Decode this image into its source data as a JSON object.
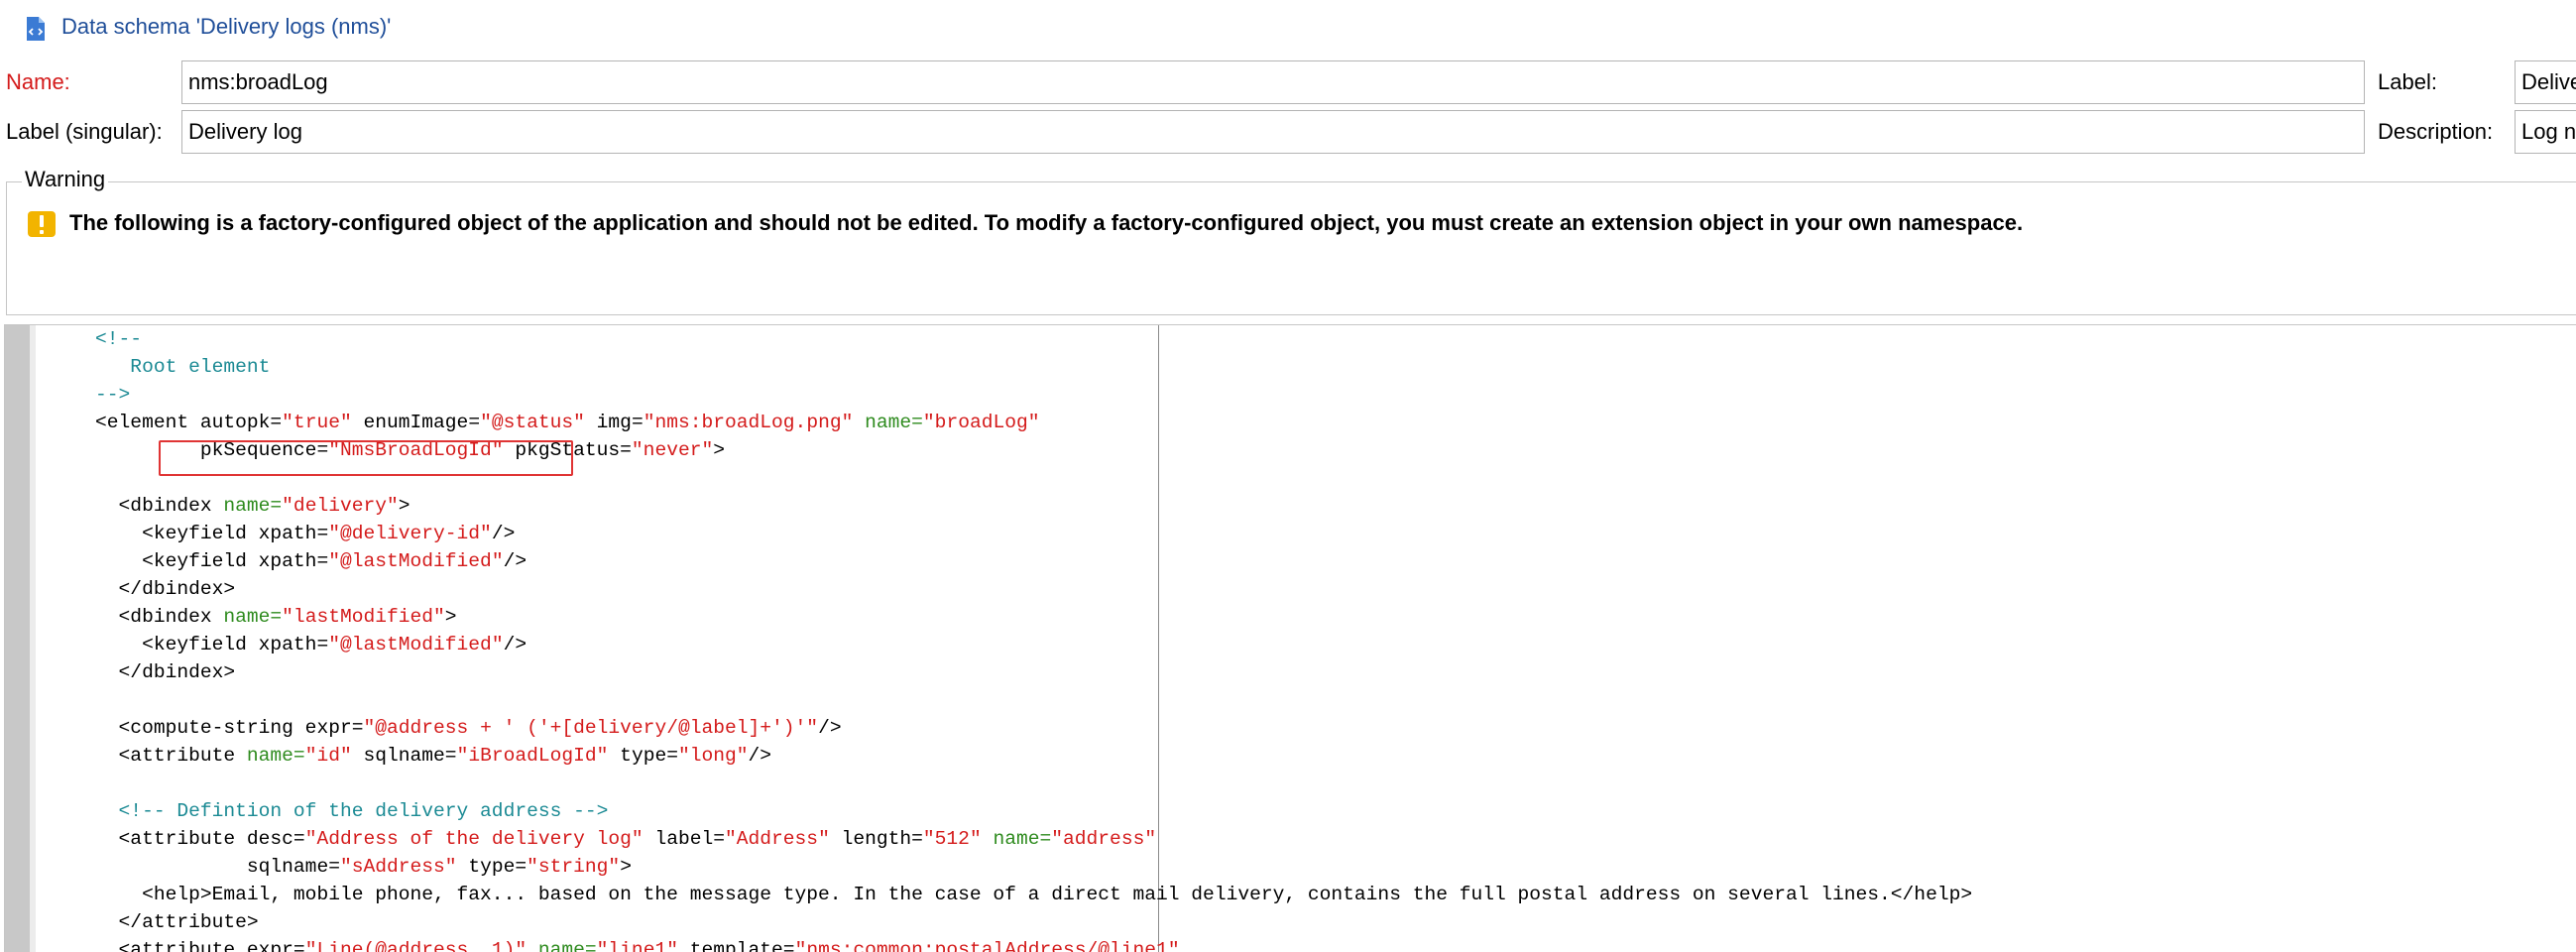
{
  "window": {
    "title": "Data schema 'Delivery logs (nms)'",
    "icon": "schema-document-icon"
  },
  "form": {
    "name_label": "Name:",
    "name_value": "nms:broadLog",
    "label_label": "Label:",
    "label_value": "Delive",
    "label_singular_label": "Label (singular):",
    "label_singular_value": "Delivery log",
    "description_label": "Description:",
    "description_value": "Log n"
  },
  "warning": {
    "legend": "Warning",
    "icon": "warning-exclamation-icon",
    "message": "The following is a factory-configured object of the application and should not be edited. To modify a factory-configured object, you must create an extension object in your own namespace."
  },
  "editor": {
    "lines": [
      [
        {
          "t": "    <!--",
          "c": "com"
        }
      ],
      [
        {
          "t": "       Root element",
          "c": "com"
        }
      ],
      [
        {
          "t": "    -->",
          "c": "com"
        }
      ],
      [
        {
          "t": "    <element autopk=",
          "c": "tag"
        },
        {
          "t": "\"true\"",
          "c": "str"
        },
        {
          "t": " enumImage=",
          "c": "tag"
        },
        {
          "t": "\"@status\"",
          "c": "str"
        },
        {
          "t": " img=",
          "c": "tag"
        },
        {
          "t": "\"nms:broadLog.png\"",
          "c": "str"
        },
        {
          "t": " name=",
          "c": "grn"
        },
        {
          "t": "\"broadLog\"",
          "c": "str"
        }
      ],
      [
        {
          "t": "             pkSequence=",
          "c": "tag"
        },
        {
          "t": "\"NmsBroadLogId\"",
          "c": "str"
        },
        {
          "t": " pkgStatus=",
          "c": "tag"
        },
        {
          "t": "\"never\"",
          "c": "str"
        },
        {
          "t": ">",
          "c": "tag"
        }
      ],
      [
        {
          "t": "",
          "c": "tag"
        }
      ],
      [
        {
          "t": "      <dbindex ",
          "c": "tag"
        },
        {
          "t": "name=",
          "c": "grn"
        },
        {
          "t": "\"delivery\"",
          "c": "str"
        },
        {
          "t": ">",
          "c": "tag"
        }
      ],
      [
        {
          "t": "        <keyfield xpath=",
          "c": "tag"
        },
        {
          "t": "\"@delivery-id\"",
          "c": "str"
        },
        {
          "t": "/>",
          "c": "tag"
        }
      ],
      [
        {
          "t": "        <keyfield xpath=",
          "c": "tag"
        },
        {
          "t": "\"@lastModified\"",
          "c": "str"
        },
        {
          "t": "/>",
          "c": "tag"
        }
      ],
      [
        {
          "t": "      </dbindex>",
          "c": "tag"
        }
      ],
      [
        {
          "t": "      <dbindex ",
          "c": "tag"
        },
        {
          "t": "name=",
          "c": "grn"
        },
        {
          "t": "\"lastModified\"",
          "c": "str"
        },
        {
          "t": ">",
          "c": "tag"
        }
      ],
      [
        {
          "t": "        <keyfield xpath=",
          "c": "tag"
        },
        {
          "t": "\"@lastModified\"",
          "c": "str"
        },
        {
          "t": "/>",
          "c": "tag"
        }
      ],
      [
        {
          "t": "      </dbindex>",
          "c": "tag"
        }
      ],
      [
        {
          "t": "",
          "c": "tag"
        }
      ],
      [
        {
          "t": "      <compute-string expr=",
          "c": "tag"
        },
        {
          "t": "\"@address + ' ('+[delivery/@label]+')'\"",
          "c": "str"
        },
        {
          "t": "/>",
          "c": "tag"
        }
      ],
      [
        {
          "t": "      <attribute ",
          "c": "tag"
        },
        {
          "t": "name=",
          "c": "grn"
        },
        {
          "t": "\"id\"",
          "c": "str"
        },
        {
          "t": " sqlname=",
          "c": "tag"
        },
        {
          "t": "\"iBroadLogId\"",
          "c": "str"
        },
        {
          "t": " type=",
          "c": "tag"
        },
        {
          "t": "\"long\"",
          "c": "str"
        },
        {
          "t": "/>",
          "c": "tag"
        }
      ],
      [
        {
          "t": "",
          "c": "tag"
        }
      ],
      [
        {
          "t": "      <!-- Defintion of the delivery address -->",
          "c": "com"
        }
      ],
      [
        {
          "t": "      <attribute desc=",
          "c": "tag"
        },
        {
          "t": "\"Address of the delivery log\"",
          "c": "str"
        },
        {
          "t": " label=",
          "c": "tag"
        },
        {
          "t": "\"Address\"",
          "c": "str"
        },
        {
          "t": " length=",
          "c": "tag"
        },
        {
          "t": "\"512\"",
          "c": "str"
        },
        {
          "t": " ",
          "c": "tag"
        },
        {
          "t": "name=",
          "c": "grn"
        },
        {
          "t": "\"address\"",
          "c": "str"
        }
      ],
      [
        {
          "t": "                 sqlname=",
          "c": "tag"
        },
        {
          "t": "\"sAddress\"",
          "c": "str"
        },
        {
          "t": " type=",
          "c": "tag"
        },
        {
          "t": "\"string\"",
          "c": "str"
        },
        {
          "t": ">",
          "c": "tag"
        }
      ],
      [
        {
          "t": "        <help>Email, mobile phone, fax... based on the message type. In the case of a direct mail delivery, contains the full postal address on several lines.</help>",
          "c": "tag"
        }
      ],
      [
        {
          "t": "      </attribute>",
          "c": "tag"
        }
      ],
      [
        {
          "t": "      <attribute expr=",
          "c": "tag"
        },
        {
          "t": "\"Line(@address, 1)\"",
          "c": "str"
        },
        {
          "t": " ",
          "c": "tag"
        },
        {
          "t": "name=",
          "c": "grn"
        },
        {
          "t": "\"line1\"",
          "c": "str"
        },
        {
          "t": " template=",
          "c": "tag"
        },
        {
          "t": "\"nms:common:postalAddress/@line1\"",
          "c": "str"
        }
      ]
    ]
  },
  "colors": {
    "title": "#1f4e99",
    "required_label": "#d41b1b",
    "comment": "#1b8a94",
    "string": "#d41b1b",
    "name_attr": "#2e8b1e",
    "highlight": "#e03434",
    "warning_icon": "#f2b400"
  }
}
